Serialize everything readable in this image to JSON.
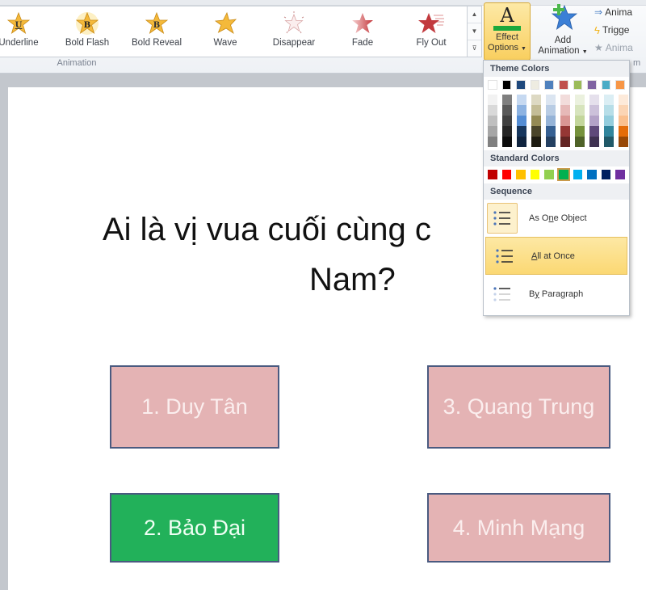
{
  "ribbon": {
    "gallery_items": [
      {
        "label": "Underline",
        "icon": "underline-star-icon"
      },
      {
        "label": "Bold Flash",
        "icon": "bold-flash-star-icon"
      },
      {
        "label": "Bold Reveal",
        "icon": "bold-reveal-star-icon"
      },
      {
        "label": "Wave",
        "icon": "wave-star-icon"
      },
      {
        "label": "Disappear",
        "icon": "disappear-star-icon"
      },
      {
        "label": "Fade",
        "icon": "fade-star-icon"
      },
      {
        "label": "Fly Out",
        "icon": "fly-out-star-icon"
      }
    ],
    "group_label": "Animation",
    "effect_options": {
      "line1": "Effect",
      "line2": "Options",
      "underline_color": "#1aa83c"
    },
    "add_animation": {
      "line1": "Add",
      "line2": "Animation"
    },
    "side_commands": [
      {
        "label": "Anima",
        "icon": "animation-pane-icon",
        "enabled": true
      },
      {
        "label": "Trigge",
        "icon": "trigger-icon",
        "enabled": true
      },
      {
        "label": "Anima",
        "icon": "animation-painter-icon",
        "enabled": false
      }
    ],
    "group_label2": "m"
  },
  "dropdown": {
    "theme_colors_header": "Theme Colors",
    "theme_top": [
      "#ffffff",
      "#000000",
      "#1f497d",
      "#eeece1",
      "#4f81bd",
      "#c0504d",
      "#9bbb59",
      "#8064a2",
      "#4bacc6",
      "#f79646"
    ],
    "theme_shades": [
      [
        "#f2f2f2",
        "#d9d9d9",
        "#bfbfbf",
        "#a6a6a6",
        "#808080"
      ],
      [
        "#7f7f7f",
        "#595959",
        "#404040",
        "#262626",
        "#0d0d0d"
      ],
      [
        "#c6d9f1",
        "#8db3e2",
        "#548dd4",
        "#17375e",
        "#10243f"
      ],
      [
        "#ddd9c3",
        "#c4bd97",
        "#948a54",
        "#4a452a",
        "#1e1c11"
      ],
      [
        "#dbe5f1",
        "#b8cce4",
        "#95b3d7",
        "#366092",
        "#244061"
      ],
      [
        "#f2dcdb",
        "#e6b9b8",
        "#d99694",
        "#953735",
        "#632523"
      ],
      [
        "#ebf1de",
        "#d7e4bd",
        "#c3d69b",
        "#76923c",
        "#4f6228"
      ],
      [
        "#e5e0ec",
        "#ccc1da",
        "#b3a2c7",
        "#5f497a",
        "#3f3151"
      ],
      [
        "#dbeef4",
        "#b7dee8",
        "#93cddd",
        "#31859c",
        "#215968"
      ],
      [
        "#fdeada",
        "#fbd5b5",
        "#fac08f",
        "#e46c0a",
        "#984807"
      ]
    ],
    "standard_colors_header": "Standard Colors",
    "standard_colors": [
      "#c00000",
      "#ff0000",
      "#ffc000",
      "#ffff00",
      "#92d050",
      "#00b050",
      "#00b0f0",
      "#0070c0",
      "#002060",
      "#7030a0"
    ],
    "standard_selected_index": 5,
    "sequence_header": "Sequence",
    "sequence_items": [
      {
        "pre": "As O",
        "ul": "n",
        "post": "e Object",
        "state": "selected"
      },
      {
        "pre": "",
        "ul": "A",
        "post": "ll at Once",
        "state": "hover"
      },
      {
        "pre": "B",
        "ul": "y",
        "post": " Paragraph",
        "state": "normal"
      }
    ]
  },
  "slide": {
    "title_line1": "Ai là vị vua cuối cùng c",
    "title_line2": "Nam?",
    "answers": [
      {
        "label": "1. Duy Tân",
        "correct": false
      },
      {
        "label": "3. Quang Trung",
        "correct": false
      },
      {
        "label": "2. Bảo Đại",
        "correct": true
      },
      {
        "label": "4. Minh Mạng",
        "correct": false
      }
    ]
  }
}
